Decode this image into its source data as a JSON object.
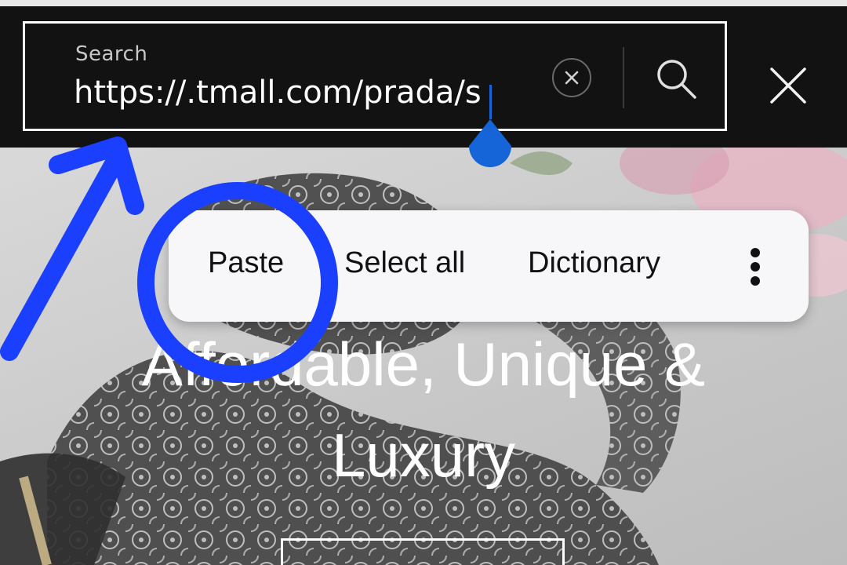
{
  "search": {
    "label": "Search",
    "value": "https://.tmall.com/prada/s"
  },
  "icons": {
    "clear": "clear-circle-icon",
    "search": "search-icon",
    "close": "close-icon",
    "more": "more-vertical-icon",
    "handle": "text-selection-handle-icon"
  },
  "context_menu": {
    "items": [
      {
        "label": "Paste"
      },
      {
        "label": "Select all"
      },
      {
        "label": "Dictionary"
      }
    ]
  },
  "hero": {
    "title_line1": "Affordable, Unique &",
    "title_line2": "Luxury"
  },
  "annotation": {
    "color": "#1a3fff"
  },
  "colors": {
    "search_bg": "#121212",
    "handle": "#1565d8",
    "menu_bg": "#f7f7f9"
  }
}
